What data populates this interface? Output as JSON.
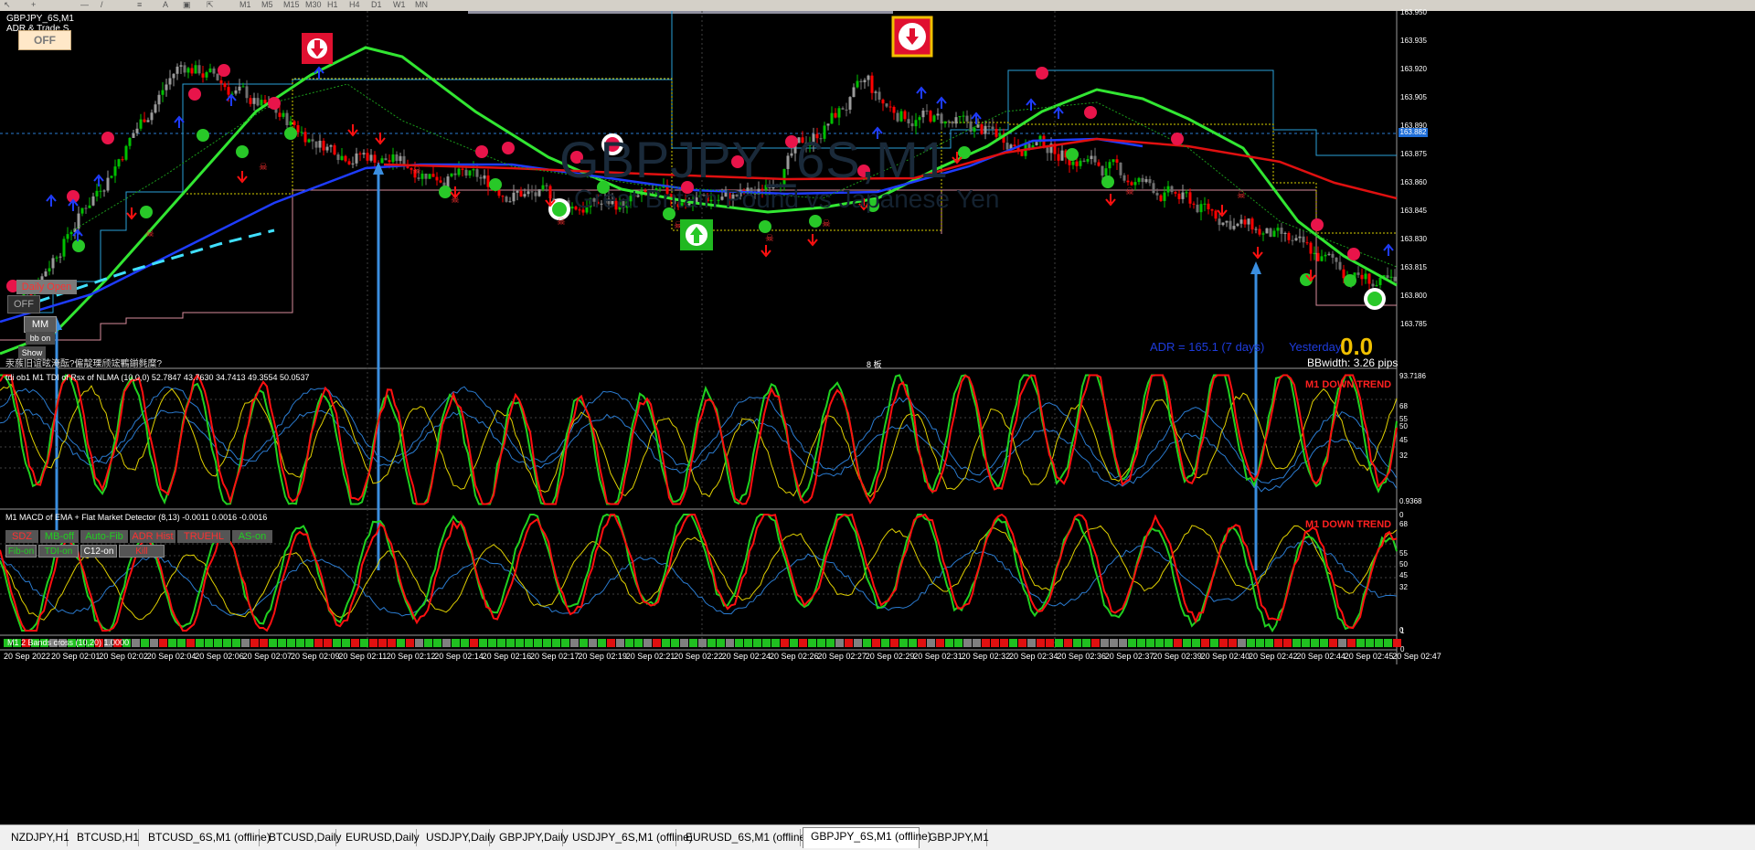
{
  "toolbar": {
    "buttons": [
      "M1",
      "M5",
      "M15",
      "M30",
      "H1",
      "H4",
      "D1",
      "W1",
      "MN"
    ]
  },
  "main_panel": {
    "symbol_label": "GBPJPY_6S,M1",
    "adr_label": "ADR & Trade S",
    "off_button": "OFF",
    "watermark_symbol": "GBPJPY_6S,M1",
    "watermark_desc": "Great Britain Pound vs Japanese Yen",
    "daily_open": "Daily Open",
    "off_button2": "OFF",
    "mm_button": "MM",
    "bb_on_button": "bb on",
    "show_button": "Show",
    "garbled_text": "汞蔟旧谊昡淹酝?僱靛瑮颀竤鷝鎆毵糜?",
    "adr_text": "ADR = 165.1  (7 days)",
    "yesterday_label": "Yesterday",
    "big_value": "0.0",
    "bbwidth_label": "BBwidth: 3.26 pips",
    "center_marker": "8 板",
    "price_tag": "163.882",
    "price_scale": [
      "163.950",
      "163.935",
      "163.920",
      "163.905",
      "163.890",
      "163.875",
      "163.860",
      "163.845",
      "163.830",
      "163.815",
      "163.800",
      "163.785"
    ]
  },
  "rsi_panel": {
    "label": "tdi ob1 M1 TDI of Rsx of NLMA (10,0,0) 52.7847 43.7630 34.7413 49.3554 50.0537",
    "trend": "M1 DOWN TREND",
    "scale": [
      "93.7186",
      "68",
      "55",
      "50",
      "45",
      "32",
      "0.9368"
    ]
  },
  "macd_panel": {
    "label": "M1 MACD of EMA + Flat Market Detector (8,13) -0.0011 0.0016 -0.0016",
    "trend": "M1 DOWN TREND",
    "scale": [
      "0",
      "68",
      "55",
      "50",
      "45",
      "32",
      "0"
    ],
    "buttons_row1": [
      "SDZ",
      "MB-off",
      "Auto-Fib",
      "ADR Hist",
      "TRUEHL",
      "AS-on"
    ],
    "buttons_row2": [
      "Fib-on",
      "TDI-on",
      "C12-on",
      "Kill"
    ]
  },
  "bands_panel": {
    "label": "M1 2 Bands cross (10,20) 1.0000",
    "scale_top": "1",
    "scale_bottom": "0"
  },
  "time_axis": [
    "20 Sep 2022",
    "20 Sep 02:01",
    "20 Sep 02:02",
    "20 Sep 02:04",
    "20 Sep 02:06",
    "20 Sep 02:07",
    "20 Sep 02:09",
    "20 Sep 02:11",
    "20 Sep 02:12",
    "20 Sep 02:14",
    "20 Sep 02:16",
    "20 Sep 02:17",
    "20 Sep 02:19",
    "20 Sep 02:21",
    "20 Sep 02:22",
    "20 Sep 02:24",
    "20 Sep 02:26",
    "20 Sep 02:27",
    "20 Sep 02:29",
    "20 Sep 02:31",
    "20 Sep 02:32",
    "20 Sep 02:34",
    "20 Sep 02:36",
    "20 Sep 02:37",
    "20 Sep 02:39",
    "20 Sep 02:40",
    "20 Sep 02:42",
    "20 Sep 02:44",
    "20 Sep 02:45",
    "20 Sep 02:47"
  ],
  "tabs": [
    "NZDJPY,H1",
    "BTCUSD,H1",
    "BTCUSD_6S,M1 (offline)",
    "BTCUSD,Daily",
    "EURUSD,Daily",
    "USDJPY,Daily",
    "GBPJPY,Daily",
    "USDJPY_6S,M1 (offline)",
    "EURUSD_6S,M1 (offline)",
    "GBPJPY_6S,M1 (offline)",
    "GBPJPY,M1"
  ],
  "active_tab_index": 9,
  "colors": {
    "background": "#000000",
    "bull_candle": "#00c000",
    "bear_candle": "#ff0000",
    "green_ma": "#32e632",
    "blue_ma": "#1e3cff",
    "red_ma": "#e01010",
    "trend_text": "#ff2020",
    "arrow_blue": "#3a8ee0"
  }
}
